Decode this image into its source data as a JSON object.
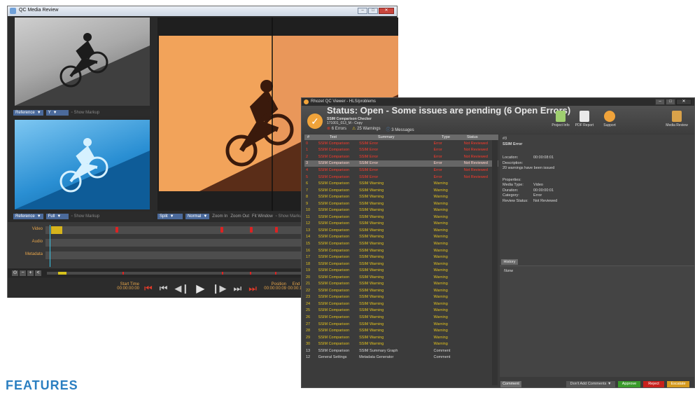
{
  "media_review": {
    "title": "QC Media Review",
    "left_top": {
      "ref": "Reference",
      "channel": "Y",
      "show_markup": "Show Markup"
    },
    "left_bottom": {
      "ref": "Reference",
      "channel": "Full",
      "show_markup": "Show Markup"
    },
    "right": {
      "mode": "Split",
      "view": "Normal",
      "zoom_in": "Zoom In",
      "zoom_out": "Zoom Out",
      "fit_window": "Fit Window",
      "show_markup": "Show Markup"
    },
    "tracks": [
      "Video",
      "Audio",
      "Metadata"
    ],
    "transport": {
      "start_label": "Start Time",
      "start_value": "00:00:00:00",
      "position_label": "Position",
      "position_value": "00:00:00:09",
      "end_label": "End Time",
      "end_value": "00:00:12:02"
    },
    "zoom_buttons": [
      "⊙",
      "−",
      "+",
      "<"
    ]
  },
  "qc_viewer": {
    "title": "Rhozet QC Viewer - HLS/problems",
    "status_title": "Status: Open - Some issues are pending (6 Open Errors)",
    "checker_name": "SSIM Comparison Checker",
    "file_name": "171001_013_M - Copy",
    "counts": {
      "errors": "6 Errors",
      "warnings": "25 Warnings",
      "messages": "3 Messages"
    },
    "toolbar": [
      {
        "label": "Project Info",
        "color": "#9fcf6f"
      },
      {
        "label": "PDF Report",
        "color": "#e9e9e9"
      },
      {
        "label": "Support",
        "color": "#f0a33a"
      }
    ],
    "media_review_label": "Media Review",
    "columns": {
      "num": "#",
      "test": "Test",
      "summary": "Summary",
      "type": "Type",
      "status": "Status"
    },
    "rows": [
      {
        "n": "0",
        "test": "SSIM Comparison",
        "summary": "SSIM Error",
        "type": "Error",
        "status": "Not Reviewed",
        "kind": "err"
      },
      {
        "n": "1",
        "test": "SSIM Comparison",
        "summary": "SSIM Error",
        "type": "Error",
        "status": "Not Reviewed",
        "kind": "err"
      },
      {
        "n": "2",
        "test": "SSIM Comparison",
        "summary": "SSIM Error",
        "type": "Error",
        "status": "Not Reviewed",
        "kind": "err"
      },
      {
        "n": "3",
        "test": "SSIM Comparison",
        "summary": "SSIM Error",
        "type": "Error",
        "status": "Not Reviewed",
        "kind": "sel"
      },
      {
        "n": "4",
        "test": "SSIM Comparison",
        "summary": "SSIM Error",
        "type": "Error",
        "status": "Not Reviewed",
        "kind": "err"
      },
      {
        "n": "5",
        "test": "SSIM Comparison",
        "summary": "SSIM Error",
        "type": "Error",
        "status": "Not Reviewed",
        "kind": "err"
      },
      {
        "n": "6",
        "test": "SSIM Comparison",
        "summary": "SSIM Warning",
        "type": "Warning",
        "status": "",
        "kind": "wrn"
      },
      {
        "n": "7",
        "test": "SSIM Comparison",
        "summary": "SSIM Warning",
        "type": "Warning",
        "status": "",
        "kind": "wrn"
      },
      {
        "n": "8",
        "test": "SSIM Comparison",
        "summary": "SSIM Warning",
        "type": "Warning",
        "status": "",
        "kind": "wrn"
      },
      {
        "n": "9",
        "test": "SSIM Comparison",
        "summary": "SSIM Warning",
        "type": "Warning",
        "status": "",
        "kind": "wrn"
      },
      {
        "n": "10",
        "test": "SSIM Comparison",
        "summary": "SSIM Warning",
        "type": "Warning",
        "status": "",
        "kind": "wrn"
      },
      {
        "n": "11",
        "test": "SSIM Comparison",
        "summary": "SSIM Warning",
        "type": "Warning",
        "status": "",
        "kind": "wrn"
      },
      {
        "n": "12",
        "test": "SSIM Comparison",
        "summary": "SSIM Warning",
        "type": "Warning",
        "status": "",
        "kind": "wrn"
      },
      {
        "n": "13",
        "test": "SSIM Comparison",
        "summary": "SSIM Warning",
        "type": "Warning",
        "status": "",
        "kind": "wrn"
      },
      {
        "n": "14",
        "test": "SSIM Comparison",
        "summary": "SSIM Warning",
        "type": "Warning",
        "status": "",
        "kind": "wrn"
      },
      {
        "n": "15",
        "test": "SSIM Comparison",
        "summary": "SSIM Warning",
        "type": "Warning",
        "status": "",
        "kind": "wrn"
      },
      {
        "n": "16",
        "test": "SSIM Comparison",
        "summary": "SSIM Warning",
        "type": "Warning",
        "status": "",
        "kind": "wrn"
      },
      {
        "n": "17",
        "test": "SSIM Comparison",
        "summary": "SSIM Warning",
        "type": "Warning",
        "status": "",
        "kind": "wrn"
      },
      {
        "n": "18",
        "test": "SSIM Comparison",
        "summary": "SSIM Warning",
        "type": "Warning",
        "status": "",
        "kind": "wrn"
      },
      {
        "n": "19",
        "test": "SSIM Comparison",
        "summary": "SSIM Warning",
        "type": "Warning",
        "status": "",
        "kind": "wrn"
      },
      {
        "n": "20",
        "test": "SSIM Comparison",
        "summary": "SSIM Warning",
        "type": "Warning",
        "status": "",
        "kind": "wrn"
      },
      {
        "n": "21",
        "test": "SSIM Comparison",
        "summary": "SSIM Warning",
        "type": "Warning",
        "status": "",
        "kind": "wrn"
      },
      {
        "n": "22",
        "test": "SSIM Comparison",
        "summary": "SSIM Warning",
        "type": "Warning",
        "status": "",
        "kind": "wrn"
      },
      {
        "n": "23",
        "test": "SSIM Comparison",
        "summary": "SSIM Warning",
        "type": "Warning",
        "status": "",
        "kind": "wrn"
      },
      {
        "n": "24",
        "test": "SSIM Comparison",
        "summary": "SSIM Warning",
        "type": "Warning",
        "status": "",
        "kind": "wrn"
      },
      {
        "n": "25",
        "test": "SSIM Comparison",
        "summary": "SSIM Warning",
        "type": "Warning",
        "status": "",
        "kind": "wrn"
      },
      {
        "n": "26",
        "test": "SSIM Comparison",
        "summary": "SSIM Warning",
        "type": "Warning",
        "status": "",
        "kind": "wrn"
      },
      {
        "n": "27",
        "test": "SSIM Comparison",
        "summary": "SSIM Warning",
        "type": "Warning",
        "status": "",
        "kind": "wrn"
      },
      {
        "n": "28",
        "test": "SSIM Comparison",
        "summary": "SSIM Warning",
        "type": "Warning",
        "status": "",
        "kind": "wrn"
      },
      {
        "n": "29",
        "test": "SSIM Comparison",
        "summary": "SSIM Warning",
        "type": "Warning",
        "status": "",
        "kind": "wrn"
      },
      {
        "n": "30",
        "test": "SSIM Comparison",
        "summary": "SSIM Warning",
        "type": "Warning",
        "status": "",
        "kind": "wrn"
      },
      {
        "n": "13",
        "test": "SSIM Comparison",
        "summary": "SSIM Summary Graph",
        "type": "Comment",
        "status": "",
        "kind": "cmt"
      },
      {
        "n": "12",
        "test": "General Settings",
        "summary": "Metadata Generator",
        "type": "Comment",
        "status": "",
        "kind": "cmt"
      }
    ],
    "detail": {
      "number": "#3",
      "title": "SSIM Error",
      "location_label": "Location:",
      "location_value": "00:00:08:01",
      "description_label": "Description:",
      "description_text": "20 warnings have been issued",
      "properties_label": "Properties:",
      "media_type_label": "Media Type:",
      "media_type_value": "Video",
      "duration_label": "Duration:",
      "duration_value": "00:00:00:01",
      "category_label": "Category:",
      "category_value": "Error",
      "review_label": "Review Status:",
      "review_value": "Not Reviewed"
    },
    "history_tab": "History",
    "history_text": "None",
    "buttons": {
      "comment": "Comment",
      "dont_add": "Don't Add Comments",
      "approve": "Approve",
      "reject": "Reject",
      "escalate": "Escalate"
    },
    "colors": {
      "approve": "#3a9a2a",
      "reject": "#c8201c",
      "escalate": "#d59a1f",
      "error": "#ff3a2b",
      "warning": "#e3c21c"
    }
  },
  "page": {
    "features_heading": "FEATURES"
  }
}
